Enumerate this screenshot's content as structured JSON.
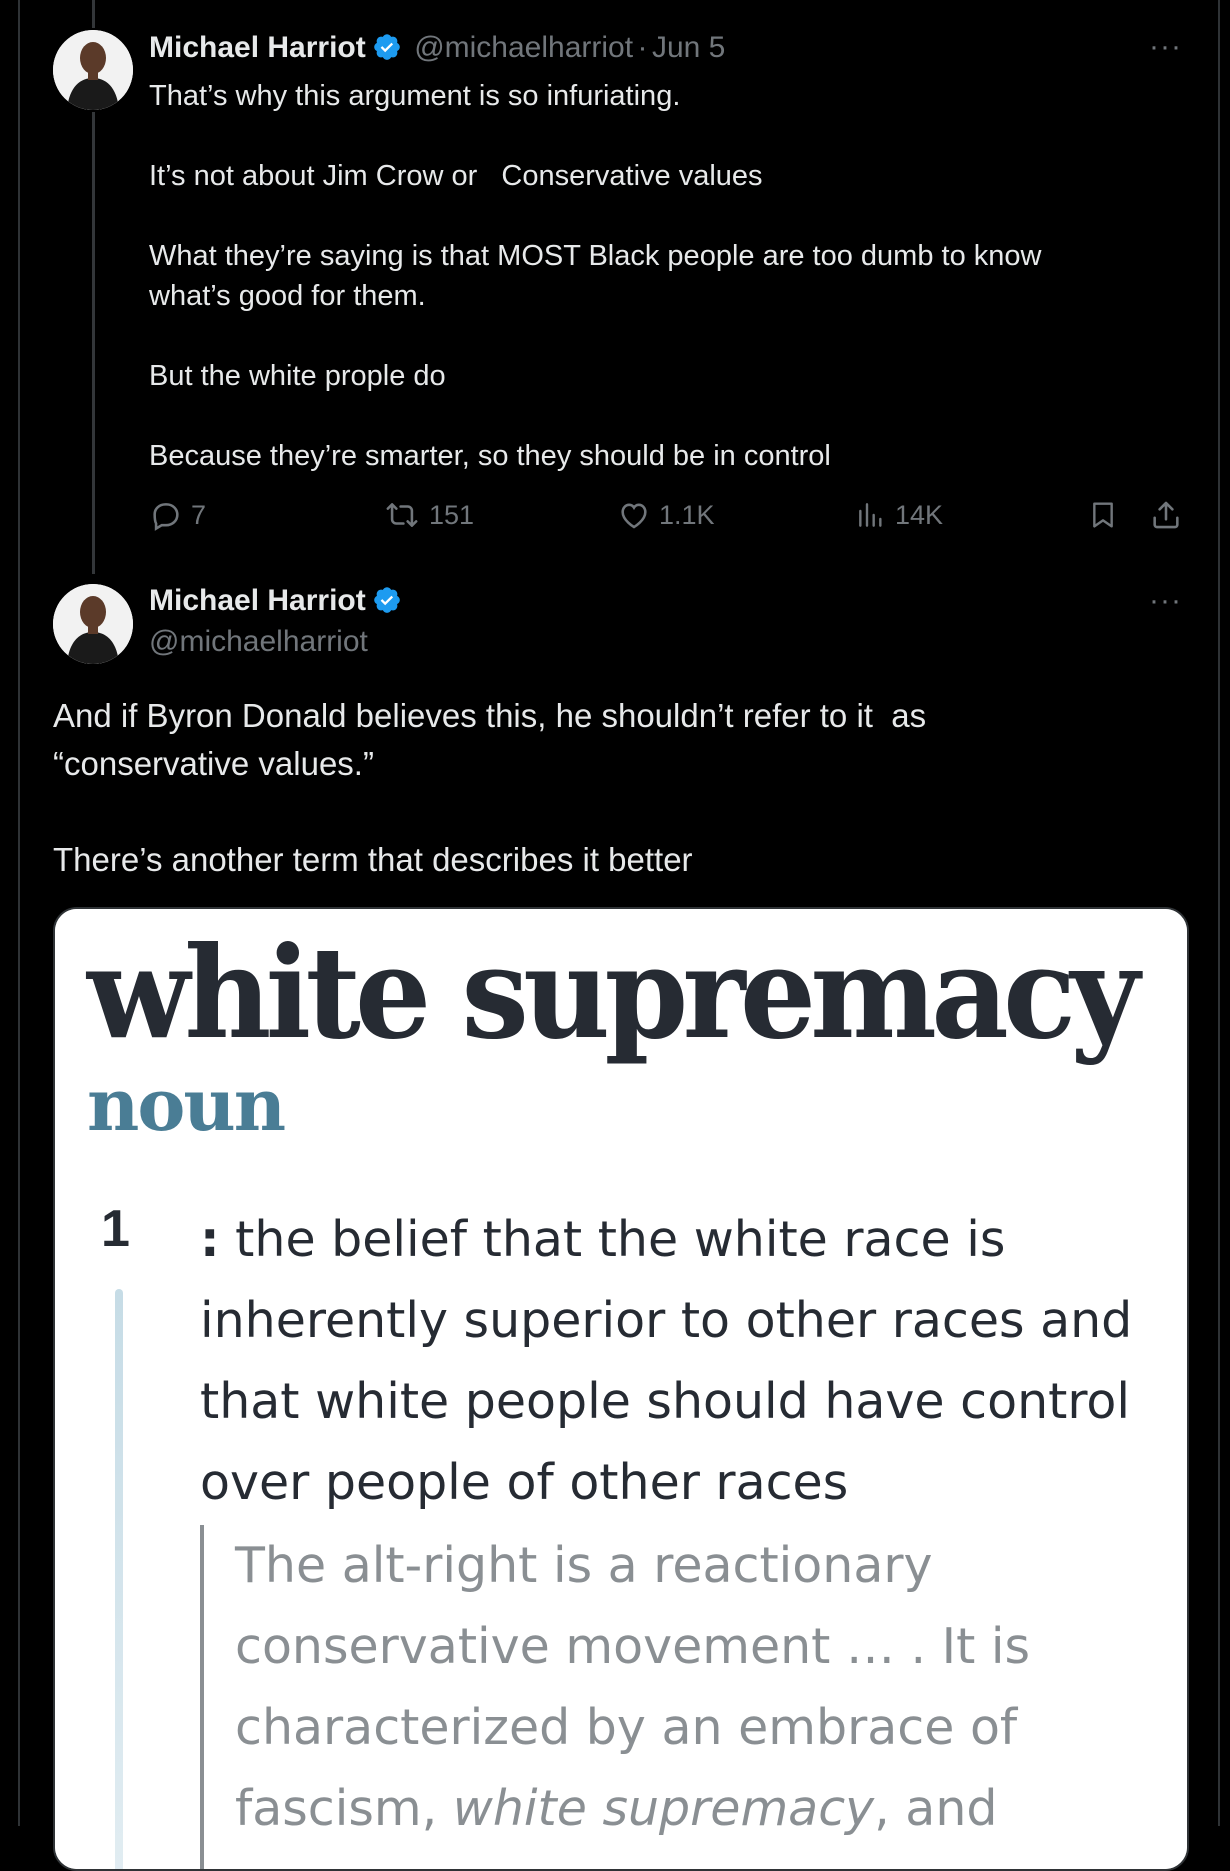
{
  "tweet1": {
    "name": "Michael Harriot",
    "handle": "@michaelharriot",
    "separator": "·",
    "date": "Jun 5",
    "more": "···",
    "paragraphs": [
      "That’s why this argument is so infuriating.",
      "It’s not about Jim Crow or   Conservative values",
      "What they’re saying is that MOST Black people are too dumb to know what’s good for them.",
      "But the white prople do",
      "Because they’re smarter, so they should be in control"
    ],
    "actions": {
      "replies": "7",
      "reposts": "151",
      "likes": "1.1K",
      "views": "14K"
    }
  },
  "tweet2": {
    "name": "Michael Harriot",
    "handle": "@michaelharriot",
    "more": "···",
    "paragraphs": [
      "And if Byron Donald believes this, he shouldn’t refer to it  as “conservative values.”",
      "There’s another term that describes it better"
    ],
    "image": {
      "headword": "white supremacy",
      "part_of_speech": "noun",
      "sense_number": "1",
      "definition_colon": ":",
      "definition": " the belief that the white race is inherently superior to other races and that white people should have control over people of other races",
      "quote_start": "The alt-right is a reactionary conservative movement … . It is characterized by an embrace of fascism, ",
      "quote_italic": "white supremacy",
      "quote_end": ", and"
    }
  },
  "colors": {
    "background": "#000000",
    "text": "#e7e9ea",
    "secondary": "#71767b",
    "verified": "#1d9bf0",
    "noun": "#4a7d95"
  },
  "icons": [
    "verified-badge-icon",
    "reply-icon",
    "repost-icon",
    "like-icon",
    "views-icon",
    "bookmark-icon",
    "share-icon",
    "more-icon"
  ]
}
